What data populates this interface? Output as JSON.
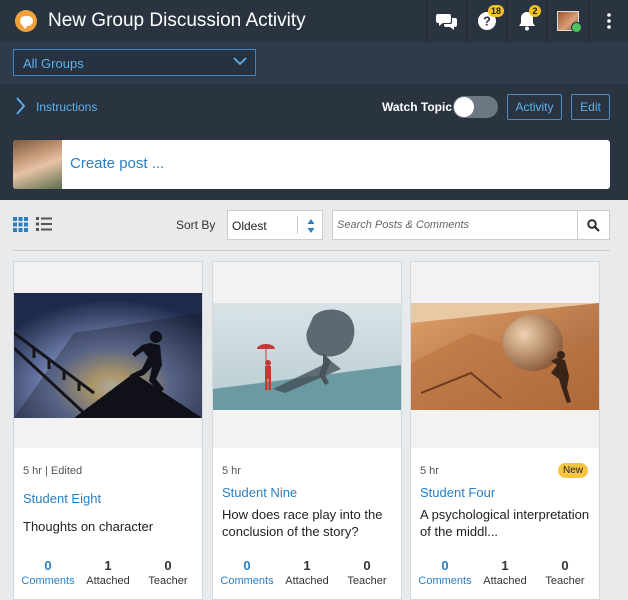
{
  "header": {
    "title": "New Group Discussion Activity",
    "help_badge": "18",
    "notif_badge": "2"
  },
  "groups": {
    "selected": "All Groups"
  },
  "instructions": {
    "label": "Instructions",
    "watch_label": "Watch Topic",
    "activity_btn": "Activity",
    "edit_btn": "Edit"
  },
  "composer": {
    "placeholder": "Create post ..."
  },
  "toolbar": {
    "sort_label": "Sort By",
    "sort_value": "Oldest",
    "search_placeholder": "Search Posts & Comments"
  },
  "posts": [
    {
      "meta": "5 hr | Edited",
      "author": "Student Eight",
      "title": "Thoughts on character",
      "is_new": false,
      "comments": "0",
      "attached": "1",
      "teacher": "0"
    },
    {
      "meta": "5 hr",
      "author": "Student Nine",
      "title": "How does race play into the conclusion of the story?",
      "is_new": false,
      "comments": "0",
      "attached": "1",
      "teacher": "0"
    },
    {
      "meta": "5 hr",
      "author": "Student Four",
      "title": "A psychological interpretation of the middl...",
      "is_new": true,
      "new_label": "New",
      "comments": "0",
      "attached": "1",
      "teacher": "0"
    }
  ],
  "stat_labels": {
    "comments": "Comments",
    "attached": "Attached",
    "teacher": "Teacher"
  },
  "colors": {
    "header_bg": "#2a3441",
    "accent": "#2a7fc0",
    "badge": "#f5c21b"
  }
}
